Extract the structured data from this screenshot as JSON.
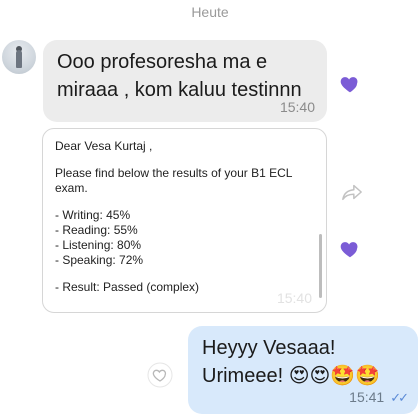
{
  "date_separator": "Heute",
  "messages": [
    {
      "direction": "incoming",
      "text": "Ooo profesoresha ma e\nmiraaa , kom kaluu testinnn",
      "time": "15:40",
      "reaction": "heart"
    },
    {
      "direction": "incoming",
      "type": "card",
      "lines": [
        "Dear Vesa Kurtaj ,",
        "",
        "Please find below the results of your B1 ECL",
        "exam.",
        "",
        "- Writing: 45%",
        "- Reading: 55%",
        "- Listening: 80%",
        "- Speaking: 72%",
        "",
        "- Result: Passed (complex)"
      ],
      "time": "15:40",
      "reaction": "heart"
    },
    {
      "direction": "outgoing",
      "text": "Heyyy Vesaaa!\nUrimeee! 😍😍🤩🤩",
      "time": "15:41",
      "status": "read"
    }
  ],
  "colors": {
    "incoming_bubble": "#ececec",
    "outgoing_bubble": "#d8e9fb",
    "reaction_heart": "#7b5cd6",
    "read_check": "#5b8ad6"
  },
  "icons": [
    "heart-icon",
    "share-icon",
    "outline-heart-icon",
    "double-check-icon"
  ]
}
